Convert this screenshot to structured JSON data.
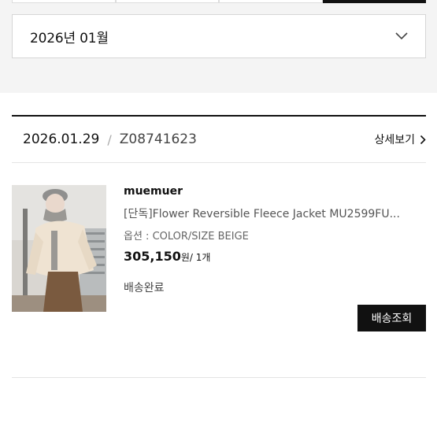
{
  "period_tabs": [
    {
      "label": "",
      "active": false
    },
    {
      "label": "",
      "active": false
    },
    {
      "label": "",
      "active": false
    },
    {
      "label": "",
      "active": true
    }
  ],
  "month_select": {
    "value": "2026년 01월",
    "icon": "chevron-down-icon"
  },
  "order": {
    "date": "2026.01.29",
    "separator": "/",
    "order_no": "Z08741623",
    "detail_label": "상세보기",
    "item": {
      "brand": "muemuer",
      "name": "[단독]Flower Reversible Fleece Jacket MU2599FU...",
      "option": "옵션 : COLOR/SIZE BEIGE",
      "price": "305,150",
      "unit": "원/ 1개",
      "status": "배송완료",
      "track_label": "배송조회"
    }
  },
  "colors": {
    "accent": "#111111",
    "panel_bg": "#f4f4f4"
  }
}
